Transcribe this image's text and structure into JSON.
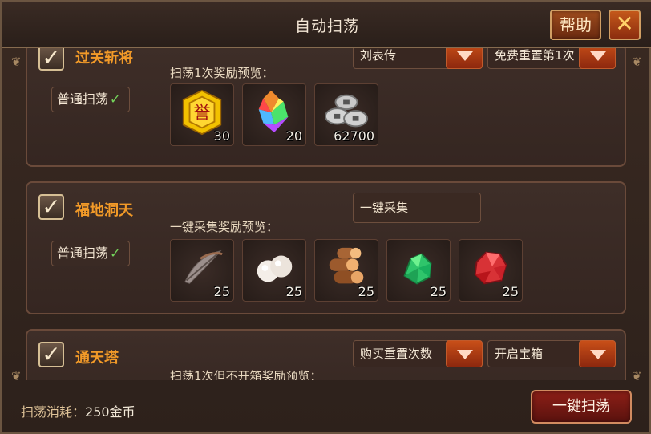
{
  "window": {
    "title": "自动扫荡",
    "help_label": "帮助",
    "close_label": "✕"
  },
  "sections": [
    {
      "title": "过关斩将",
      "mode_label": "普通扫荡",
      "preview_label": "扫荡1次奖励预览：",
      "dropdown_1": "刘表传",
      "dropdown_2": "免费重置第1次",
      "rewards": [
        {
          "icon": "honor-medal-icon",
          "qty": "30"
        },
        {
          "icon": "rainbow-crystal-icon",
          "qty": "20"
        },
        {
          "icon": "silver-coins-icon",
          "qty": "62700"
        }
      ]
    },
    {
      "title": "福地洞天",
      "mode_label": "普通扫荡",
      "preview_label": "一键采集奖励预览：",
      "collect_label": "一键采集",
      "rewards": [
        {
          "icon": "feather-icon",
          "qty": "25"
        },
        {
          "icon": "pearl-icon",
          "qty": "25"
        },
        {
          "icon": "wood-logs-icon",
          "qty": "25"
        },
        {
          "icon": "green-jade-icon",
          "qty": "25"
        },
        {
          "icon": "red-ore-icon",
          "qty": "25"
        }
      ]
    },
    {
      "title": "通天塔",
      "preview_label": "扫荡1次但不开箱奖励预览：",
      "dropdown_1": "购买重置次数",
      "dropdown_2": "开启宝箱"
    }
  ],
  "footer": {
    "cost_label": "扫荡消耗：",
    "cost_value": "250金币",
    "sweep_button": "一键扫荡"
  },
  "colors": {
    "accent_orange": "#f29a28",
    "button_red": "#8c1f17",
    "check_green": "#74d35b"
  }
}
